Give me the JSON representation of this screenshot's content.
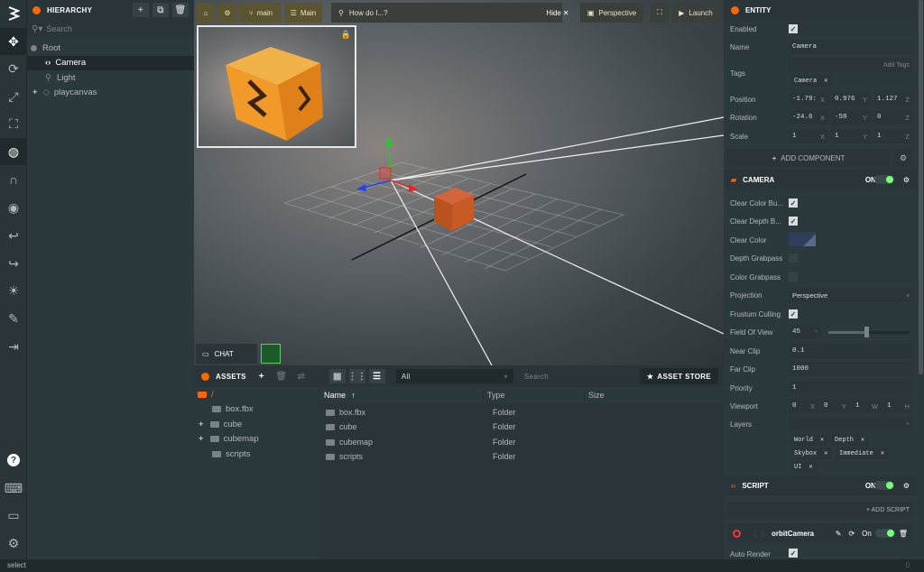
{
  "hierarchy": {
    "title": "HIERARCHY",
    "search_placeholder": "Search",
    "items": [
      {
        "label": "Root"
      },
      {
        "label": "Camera"
      },
      {
        "label": "Light"
      },
      {
        "label": "playcanvas"
      }
    ]
  },
  "viewport": {
    "branch": "main",
    "scene": "Main",
    "help_search": "How do I...?",
    "hide_label": "Hide",
    "camera_mode": "Perspective",
    "launch_label": "Launch",
    "chat_label": "CHAT"
  },
  "assets": {
    "title": "ASSETS",
    "filter": "All",
    "search_placeholder": "Search",
    "store_label": "ASSET STORE",
    "tree_root": "/",
    "tree": [
      "box.fbx",
      "cube",
      "cubemap",
      "scripts"
    ],
    "columns": {
      "name": "Name",
      "type": "Type",
      "size": "Size"
    },
    "rows": [
      {
        "name": "box.fbx",
        "type": "Folder"
      },
      {
        "name": "cube",
        "type": "Folder"
      },
      {
        "name": "cubemap",
        "type": "Folder"
      },
      {
        "name": "scripts",
        "type": "Folder"
      }
    ]
  },
  "entity": {
    "title": "ENTITY",
    "enabled_label": "Enabled",
    "name_label": "Name",
    "name_value": "Camera",
    "tags_label": "Tags",
    "add_tags": "Add Tags",
    "tag": "Camera",
    "position_label": "Position",
    "position": [
      "-1.79:",
      "0.976",
      "1.127"
    ],
    "rotation_label": "Rotation",
    "rotation": [
      "-24.6",
      "-58",
      "0"
    ],
    "scale_label": "Scale",
    "scale": [
      "1",
      "1",
      "1"
    ],
    "add_component": "ADD COMPONENT"
  },
  "camera": {
    "title": "CAMERA",
    "on_label": "ON",
    "clear_color_buffer": "Clear Color Bu...",
    "clear_depth_buffer": "Clear Depth B...",
    "clear_color": "Clear Color",
    "depth_grabpass": "Depth Grabpass",
    "color_grabpass": "Color Grabpass",
    "projection_label": "Projection",
    "projection_value": "Perspective",
    "frustum_culling": "Frustum Culling",
    "fov_label": "Field Of View",
    "fov_value": "45",
    "fov_unit": "°",
    "fov_level": 0.45,
    "near_label": "Near Clip",
    "near_value": "0.1",
    "far_label": "Far Clip",
    "far_value": "1000",
    "priority_label": "Priority",
    "priority_value": "1",
    "viewport_label": "Viewport",
    "viewport": [
      "0",
      "0",
      "1",
      "1"
    ],
    "layers_label": "Layers",
    "layers": [
      "World",
      "Depth",
      "Skybox",
      "Immediate",
      "UI"
    ]
  },
  "script": {
    "title": "SCRIPT",
    "on_label": "ON",
    "add_script": "+ ADD SCRIPT",
    "script_name": "orbitCamera",
    "script_on": "On",
    "auto_render": "Auto Render"
  },
  "status": {
    "text": "select",
    "right": "0"
  },
  "colors": {
    "accent": "#ff6600",
    "panel": "#2c393c",
    "toggle_on": "#77ff77"
  }
}
